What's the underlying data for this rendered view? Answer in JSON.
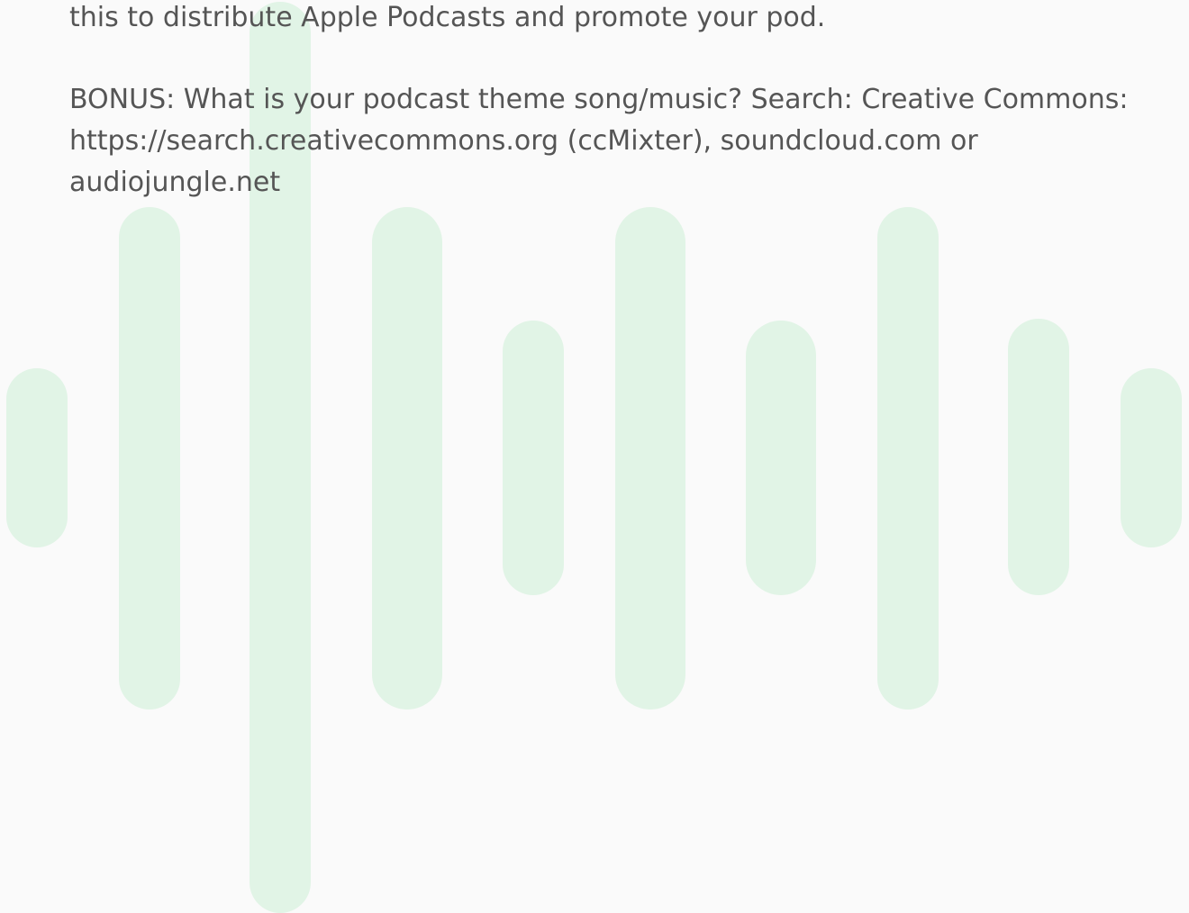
{
  "document": {
    "top_line": "this to distribute Apple Podcasts and promote your pod.",
    "bonus_paragraph": "BONUS: What is your podcast theme song/music? Search: Creative Commons: https://search.creativecommons.org (ccMixter), soundcloud.com or audiojungle.net"
  },
  "theme": {
    "background": "#fafafa",
    "text_color": "#555555",
    "waveform_color": "#e1f4e6"
  },
  "decoration": {
    "icon": "audio-waveform-icon"
  }
}
